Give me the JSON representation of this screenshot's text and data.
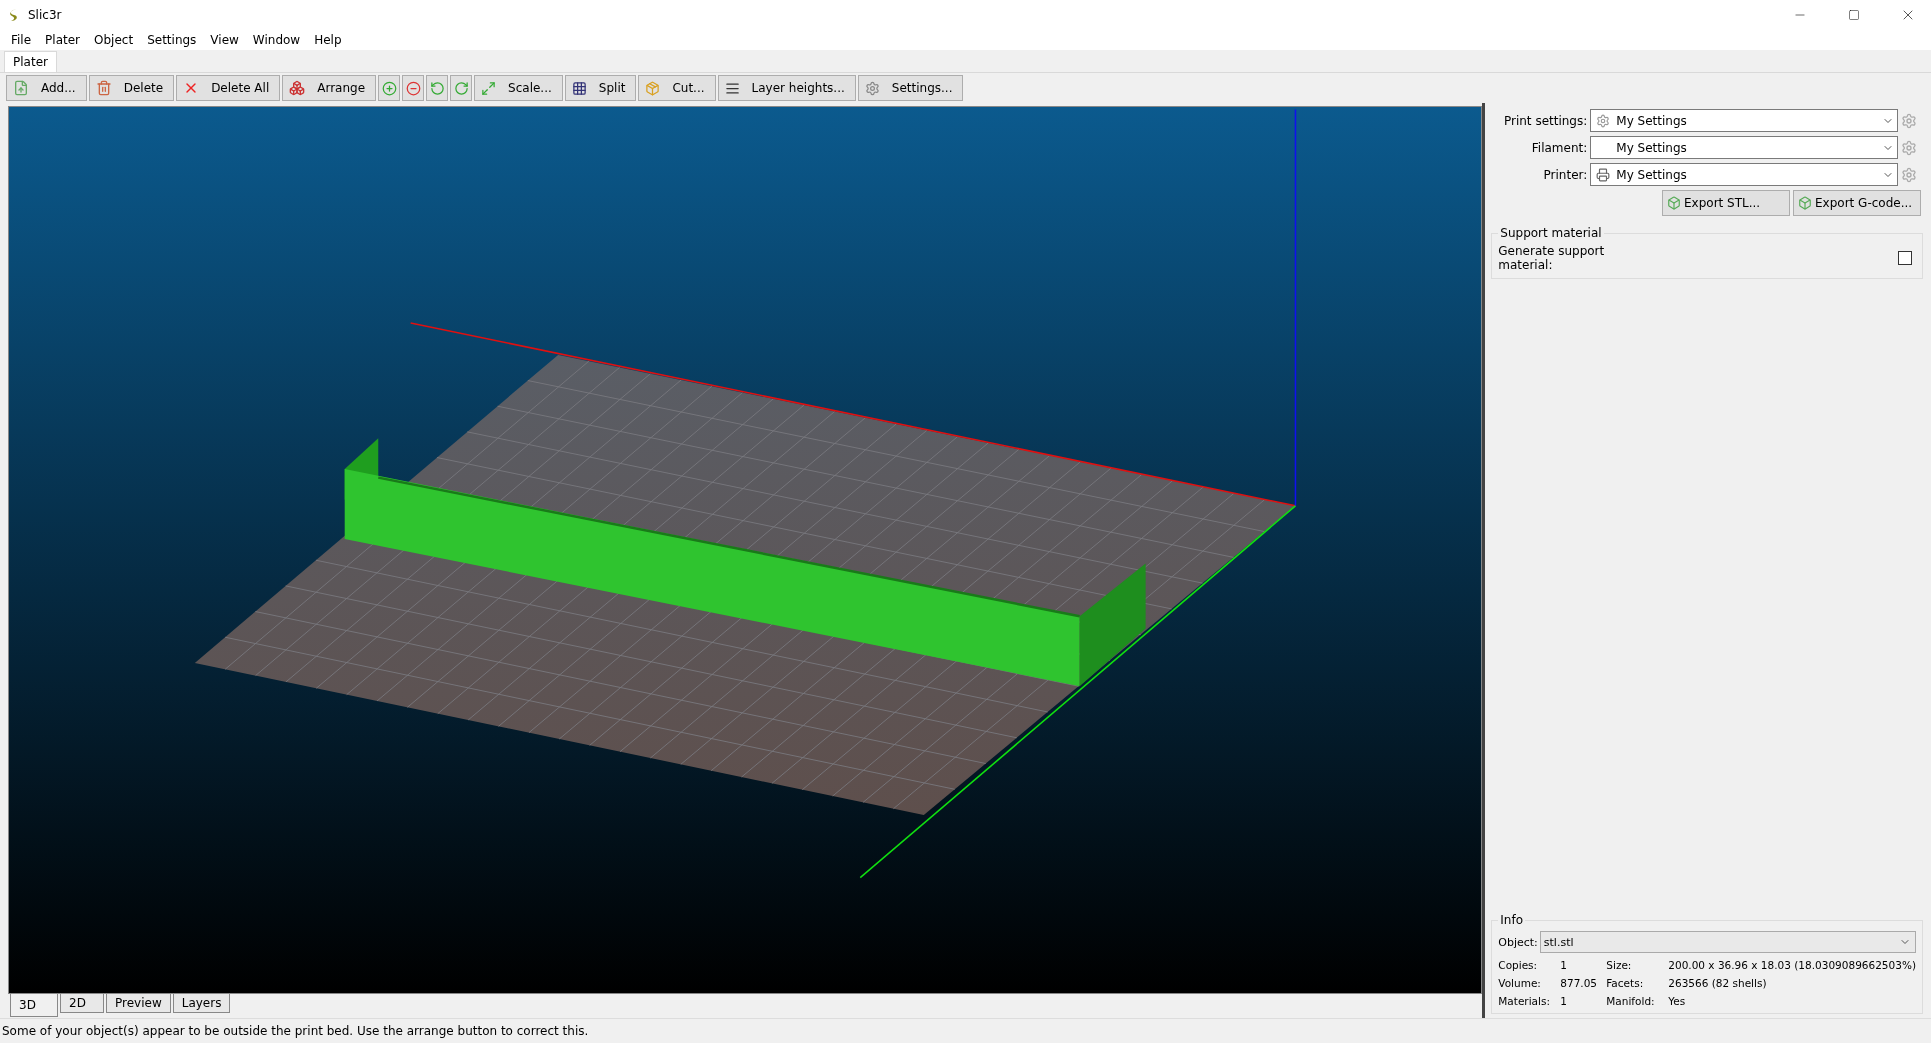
{
  "window": {
    "title": "Slic3r"
  },
  "menu": [
    "File",
    "Plater",
    "Object",
    "Settings",
    "View",
    "Window",
    "Help"
  ],
  "tabs": [
    {
      "label": "Plater",
      "selected": true
    }
  ],
  "toolbar": [
    {
      "kind": "text",
      "label": "Add..."
    },
    {
      "kind": "text",
      "label": "Delete"
    },
    {
      "kind": "text",
      "label": "Delete All"
    },
    {
      "kind": "text",
      "label": "Arrange"
    },
    {
      "kind": "icon"
    },
    {
      "kind": "icon"
    },
    {
      "kind": "icon"
    },
    {
      "kind": "icon"
    },
    {
      "kind": "text",
      "label": "Scale..."
    },
    {
      "kind": "text",
      "label": "Split"
    },
    {
      "kind": "text",
      "label": "Cut..."
    },
    {
      "kind": "text",
      "label": "Layer heights..."
    },
    {
      "kind": "text",
      "label": "Settings..."
    }
  ],
  "presets": [
    {
      "label": "Print settings:",
      "value": "My Settings"
    },
    {
      "label": "Filament:",
      "value": "My Settings"
    },
    {
      "label": "Printer:",
      "value": "My Settings"
    }
  ],
  "export_buttons": [
    "Export STL...",
    "Export G-code..."
  ],
  "support": {
    "title": "Support material",
    "label": "Generate support material:",
    "checked": false
  },
  "info": {
    "title": "Info",
    "object_label": "Object:",
    "object_value": "stl.stl",
    "rows": [
      {
        "label": "Copies:",
        "value": "1",
        "label2": "Size:",
        "value2": "200.00 x 36.96 x 18.03 (18.0309089662503%)"
      },
      {
        "label": "Volume:",
        "value": "877.05",
        "label2": "Facets:",
        "value2": "263566 (82 shells)"
      },
      {
        "label": "Materials:",
        "value": "1",
        "label2": "Manifold:",
        "value2": "Yes"
      }
    ]
  },
  "view_tabs": [
    {
      "label": "3D",
      "selected": true
    },
    {
      "label": "2D",
      "selected": false
    },
    {
      "label": "Preview",
      "selected": false
    },
    {
      "label": "Layers",
      "selected": false
    }
  ],
  "status_bar": "Some of your object(s) appear to be outside the print bed. Use the arrange button to correct this."
}
